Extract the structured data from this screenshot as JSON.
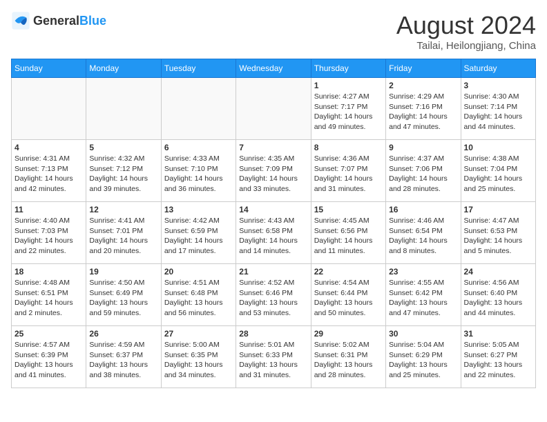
{
  "header": {
    "logo_general": "General",
    "logo_blue": "Blue",
    "month_title": "August 2024",
    "location": "Tailai, Heilongjiang, China"
  },
  "weekdays": [
    "Sunday",
    "Monday",
    "Tuesday",
    "Wednesday",
    "Thursday",
    "Friday",
    "Saturday"
  ],
  "weeks": [
    [
      {
        "day": "",
        "info": ""
      },
      {
        "day": "",
        "info": ""
      },
      {
        "day": "",
        "info": ""
      },
      {
        "day": "",
        "info": ""
      },
      {
        "day": "1",
        "info": "Sunrise: 4:27 AM\nSunset: 7:17 PM\nDaylight: 14 hours\nand 49 minutes."
      },
      {
        "day": "2",
        "info": "Sunrise: 4:29 AM\nSunset: 7:16 PM\nDaylight: 14 hours\nand 47 minutes."
      },
      {
        "day": "3",
        "info": "Sunrise: 4:30 AM\nSunset: 7:14 PM\nDaylight: 14 hours\nand 44 minutes."
      }
    ],
    [
      {
        "day": "4",
        "info": "Sunrise: 4:31 AM\nSunset: 7:13 PM\nDaylight: 14 hours\nand 42 minutes."
      },
      {
        "day": "5",
        "info": "Sunrise: 4:32 AM\nSunset: 7:12 PM\nDaylight: 14 hours\nand 39 minutes."
      },
      {
        "day": "6",
        "info": "Sunrise: 4:33 AM\nSunset: 7:10 PM\nDaylight: 14 hours\nand 36 minutes."
      },
      {
        "day": "7",
        "info": "Sunrise: 4:35 AM\nSunset: 7:09 PM\nDaylight: 14 hours\nand 33 minutes."
      },
      {
        "day": "8",
        "info": "Sunrise: 4:36 AM\nSunset: 7:07 PM\nDaylight: 14 hours\nand 31 minutes."
      },
      {
        "day": "9",
        "info": "Sunrise: 4:37 AM\nSunset: 7:06 PM\nDaylight: 14 hours\nand 28 minutes."
      },
      {
        "day": "10",
        "info": "Sunrise: 4:38 AM\nSunset: 7:04 PM\nDaylight: 14 hours\nand 25 minutes."
      }
    ],
    [
      {
        "day": "11",
        "info": "Sunrise: 4:40 AM\nSunset: 7:03 PM\nDaylight: 14 hours\nand 22 minutes."
      },
      {
        "day": "12",
        "info": "Sunrise: 4:41 AM\nSunset: 7:01 PM\nDaylight: 14 hours\nand 20 minutes."
      },
      {
        "day": "13",
        "info": "Sunrise: 4:42 AM\nSunset: 6:59 PM\nDaylight: 14 hours\nand 17 minutes."
      },
      {
        "day": "14",
        "info": "Sunrise: 4:43 AM\nSunset: 6:58 PM\nDaylight: 14 hours\nand 14 minutes."
      },
      {
        "day": "15",
        "info": "Sunrise: 4:45 AM\nSunset: 6:56 PM\nDaylight: 14 hours\nand 11 minutes."
      },
      {
        "day": "16",
        "info": "Sunrise: 4:46 AM\nSunset: 6:54 PM\nDaylight: 14 hours\nand 8 minutes."
      },
      {
        "day": "17",
        "info": "Sunrise: 4:47 AM\nSunset: 6:53 PM\nDaylight: 14 hours\nand 5 minutes."
      }
    ],
    [
      {
        "day": "18",
        "info": "Sunrise: 4:48 AM\nSunset: 6:51 PM\nDaylight: 14 hours\nand 2 minutes."
      },
      {
        "day": "19",
        "info": "Sunrise: 4:50 AM\nSunset: 6:49 PM\nDaylight: 13 hours\nand 59 minutes."
      },
      {
        "day": "20",
        "info": "Sunrise: 4:51 AM\nSunset: 6:48 PM\nDaylight: 13 hours\nand 56 minutes."
      },
      {
        "day": "21",
        "info": "Sunrise: 4:52 AM\nSunset: 6:46 PM\nDaylight: 13 hours\nand 53 minutes."
      },
      {
        "day": "22",
        "info": "Sunrise: 4:54 AM\nSunset: 6:44 PM\nDaylight: 13 hours\nand 50 minutes."
      },
      {
        "day": "23",
        "info": "Sunrise: 4:55 AM\nSunset: 6:42 PM\nDaylight: 13 hours\nand 47 minutes."
      },
      {
        "day": "24",
        "info": "Sunrise: 4:56 AM\nSunset: 6:40 PM\nDaylight: 13 hours\nand 44 minutes."
      }
    ],
    [
      {
        "day": "25",
        "info": "Sunrise: 4:57 AM\nSunset: 6:39 PM\nDaylight: 13 hours\nand 41 minutes."
      },
      {
        "day": "26",
        "info": "Sunrise: 4:59 AM\nSunset: 6:37 PM\nDaylight: 13 hours\nand 38 minutes."
      },
      {
        "day": "27",
        "info": "Sunrise: 5:00 AM\nSunset: 6:35 PM\nDaylight: 13 hours\nand 34 minutes."
      },
      {
        "day": "28",
        "info": "Sunrise: 5:01 AM\nSunset: 6:33 PM\nDaylight: 13 hours\nand 31 minutes."
      },
      {
        "day": "29",
        "info": "Sunrise: 5:02 AM\nSunset: 6:31 PM\nDaylight: 13 hours\nand 28 minutes."
      },
      {
        "day": "30",
        "info": "Sunrise: 5:04 AM\nSunset: 6:29 PM\nDaylight: 13 hours\nand 25 minutes."
      },
      {
        "day": "31",
        "info": "Sunrise: 5:05 AM\nSunset: 6:27 PM\nDaylight: 13 hours\nand 22 minutes."
      }
    ]
  ]
}
